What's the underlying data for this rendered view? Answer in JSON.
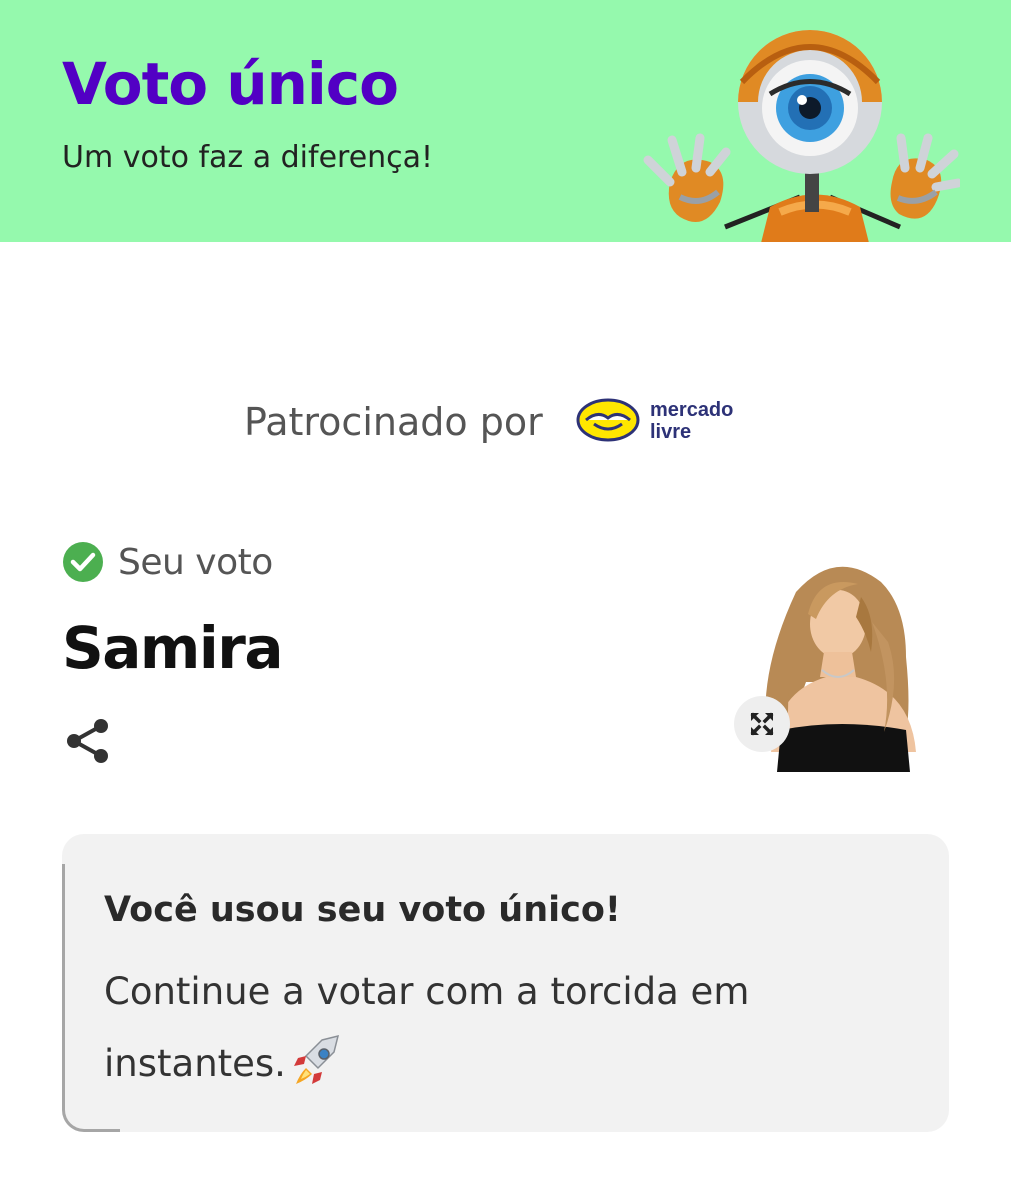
{
  "banner": {
    "title": "Voto único",
    "subtitle": "Um voto faz a diferença!",
    "mascot_icon": "big-brother-eye-mascot",
    "background_color": "#95f9ad",
    "title_color": "#5200c4"
  },
  "sponsor": {
    "label": "Patrocinado por",
    "logo_text_line1": "mercado",
    "logo_text_line2": "livre",
    "logo_icon": "handshake-icon"
  },
  "vote": {
    "status_label": "Seu voto",
    "status_icon": "check-circle-icon",
    "status_color": "#4caf50",
    "candidate_name": "Samira",
    "share_icon": "share-icon",
    "expand_icon": "expand-icon"
  },
  "info_card": {
    "title": "Você usou seu voto único!",
    "body": "Continue a votar com a torcida em instantes.",
    "emoji_icon": "rocket-icon"
  }
}
